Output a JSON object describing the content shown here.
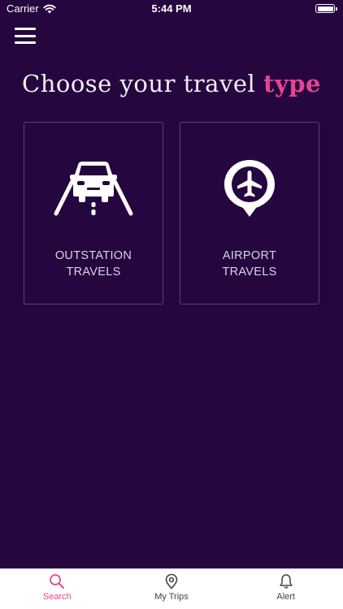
{
  "status_bar": {
    "carrier": "Carrier",
    "time": "5:44 PM"
  },
  "heading": {
    "text": "Choose your travel ",
    "accent": "type"
  },
  "options": [
    {
      "label_line1": "OUTSTATION",
      "label_line2": "TRAVELS",
      "icon": "car-on-road-icon"
    },
    {
      "label_line1": "AIRPORT",
      "label_line2": "TRAVELS",
      "icon": "airport-pin-icon"
    }
  ],
  "tabs": [
    {
      "label": "Search",
      "icon": "search-icon",
      "active": true
    },
    {
      "label": "My Trips",
      "icon": "location-pin-icon",
      "active": false
    },
    {
      "label": "Alert",
      "icon": "bell-icon",
      "active": false
    }
  ],
  "colors": {
    "background": "#25063f",
    "accent": "#e8458e",
    "card_border": "#5a4870",
    "tab_bar": "#ffffff"
  }
}
